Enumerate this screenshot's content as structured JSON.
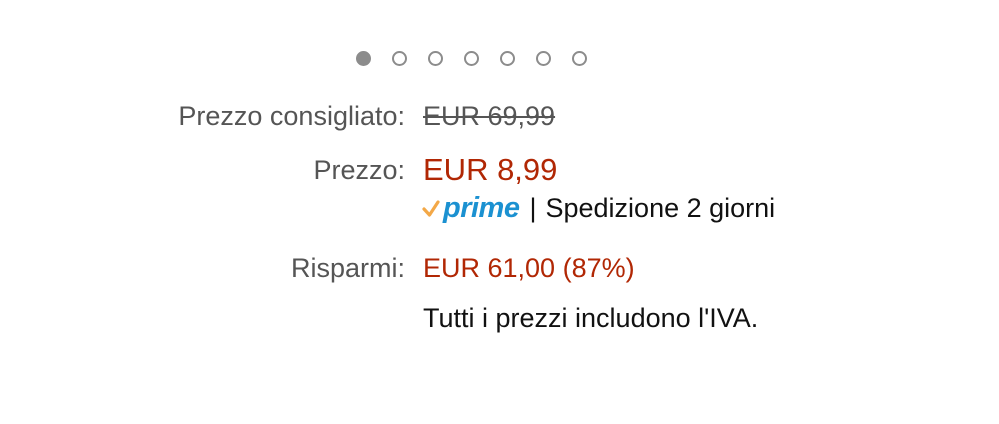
{
  "carousel": {
    "dot_count": 7,
    "active_index": 0
  },
  "pricing": {
    "list_price_label": "Prezzo consigliato:",
    "list_price_value": "EUR 69,99",
    "price_label": "Prezzo:",
    "price_value": "EUR 8,99",
    "prime_logo_text": "prime",
    "prime_separator": "|",
    "prime_shipping": "Spedizione 2 giorni",
    "savings_label": "Risparmi:",
    "savings_value": "EUR 61,00 (87%)",
    "vat_note": "Tutti i prezzi includono l'IVA."
  },
  "colors": {
    "price_red": "#b12704",
    "prime_blue": "#1b91d1",
    "prime_check_orange": "#f3a847",
    "label_gray": "#555555",
    "dot_gray": "#8c8c8c"
  }
}
